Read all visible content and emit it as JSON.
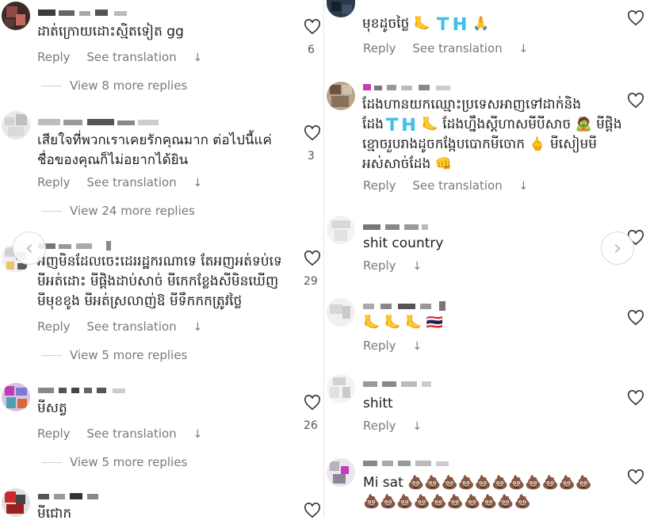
{
  "actions": {
    "reply": "Reply",
    "see_translation": "See translation"
  },
  "left": {
    "comments": [
      {
        "text": [
          "ដាត់ក្រោយដោះស្មិតទៀត gg"
        ],
        "count": "6",
        "more_replies": "View 8 more replies"
      },
      {
        "text": [
          "เสียใจที่พวกเราเคยรักคุณมาก ต่อไปนี้แค่",
          "ชื่อของคุณก็ไม่อยากได้ยิน"
        ],
        "count": "3",
        "more_replies": "View 24 more replies"
      },
      {
        "text": [
          "អញមិនដែលចេះដេររដ្ឋករណាទេ តែអញអត់ទប់ទេ",
          "មីអត់ដោះ មីផ្ដិងដាប់សាច់ មីកេកខ្លែងសីមិនឃើញ",
          "មីមុខខូង មីអត់ស្រលាញ់ឱ មីទឹកកកត្រូវថ្លៃ"
        ],
        "count": "29",
        "more_replies": "View 5 more replies"
      },
      {
        "text": [
          "មីសត្វ"
        ],
        "count": "26",
        "more_replies": "View 5 more replies"
      },
      {
        "text": [
          "មីជោក"
        ],
        "count": ""
      }
    ]
  },
  "right": {
    "comments": [
      {
        "text": [
          "មុខដូចថ្លៃ 🦶 🇹🇭 🙏"
        ]
      },
      {
        "text": [
          "ដែងហានយកឈ្មោះប្រទេសអាញទៅដាក់និង",
          "ដែង🇹🇭 🦶 ដែងហ្នឹងស្ដីហាសមីបីសាច 🧟 មីផ្ដិង",
          "ខ្មោចរួបរាងដូចកង្កែបបោកមីចោក 🖕 មីសៀមមី",
          "អស់សាច់ដែង 👊"
        ]
      },
      {
        "text": [
          "shit country"
        ]
      },
      {
        "text": [
          "🦶 🦶 🦶 🇹🇭"
        ]
      },
      {
        "text": [
          "shitt"
        ]
      },
      {
        "text": [
          "Mi sat 💩💩💩💩💩💩💩💩💩💩💩",
          "💩💩💩💩💩💩💩💩💩💩"
        ]
      }
    ]
  },
  "icons": {
    "heart": "heart-outline-icon",
    "prev": "chevron-left-icon",
    "next": "chevron-right-icon",
    "arrow": "down-arrow-icon"
  },
  "colors": {
    "muted_text": "#7a7a7a",
    "body_text": "#1c1c1c",
    "divider": "#e4e4e4"
  }
}
